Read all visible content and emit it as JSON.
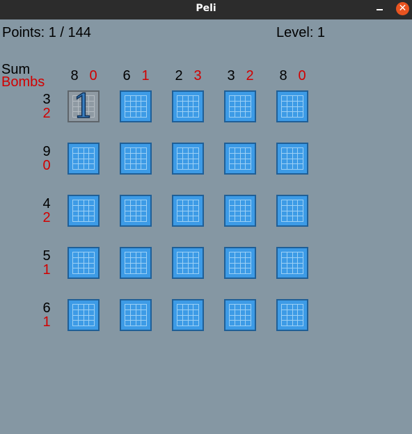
{
  "window": {
    "title": "Peli",
    "close_glyph": "✕"
  },
  "header": {
    "points_label": "Points: 1 / 144",
    "level_label": "Level: 1"
  },
  "legend": {
    "sum_label": "Sum",
    "bombs_label": "Bombs"
  },
  "columns": [
    {
      "sum": "8",
      "bombs": "0"
    },
    {
      "sum": "6",
      "bombs": "1"
    },
    {
      "sum": "2",
      "bombs": "3"
    },
    {
      "sum": "3",
      "bombs": "2"
    },
    {
      "sum": "8",
      "bombs": "0"
    }
  ],
  "rows": [
    {
      "sum": "3",
      "bombs": "2"
    },
    {
      "sum": "9",
      "bombs": "0"
    },
    {
      "sum": "4",
      "bombs": "2"
    },
    {
      "sum": "5",
      "bombs": "1"
    },
    {
      "sum": "6",
      "bombs": "1"
    }
  ],
  "revealed": {
    "row": 0,
    "col": 0,
    "value": "1"
  },
  "colors": {
    "background": "#8597a3",
    "tile": "#3d9be6",
    "tile_border": "#1f5f97",
    "bombs_text": "#d10000",
    "close_button": "#e95420"
  }
}
